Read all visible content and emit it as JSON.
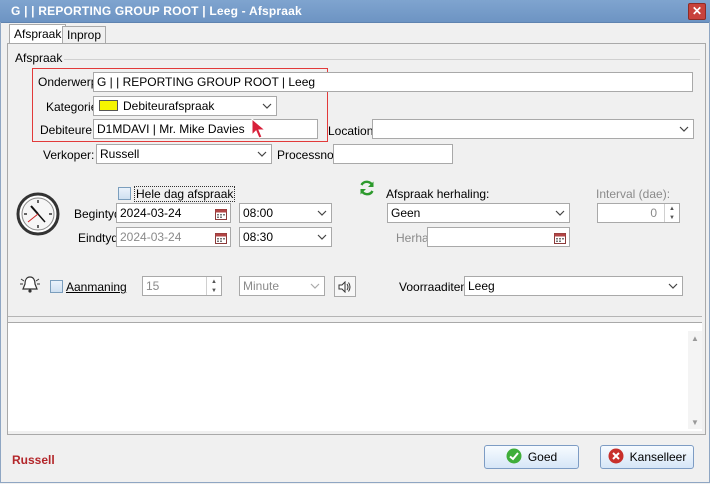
{
  "window": {
    "title": "G |  | REPORTING GROUP ROOT | Leeg - Afspraak",
    "close_glyph": "✕"
  },
  "tabs": [
    {
      "label": "Afspraak",
      "active": true
    },
    {
      "label": "Inprop",
      "active": false
    }
  ],
  "group": {
    "label": "Afspraak"
  },
  "fields": {
    "onderwerp_label": "Onderwerp",
    "onderwerp_value": "G |  | REPORTING GROUP ROOT | Leeg",
    "kategorie_label": "Kategorie",
    "kategorie_value": "Debiteurafspraak",
    "kategorie_color": "#f5f500",
    "debiteure_label": "Debiteure:",
    "debiteure_value": "D1MDAVI | Mr. Mike Davies",
    "location_label": "Location",
    "location_value": "",
    "verkoper_label": "Verkoper:",
    "verkoper_value": "Russell",
    "processno_label": "Processno:",
    "processno_value": ""
  },
  "schedule": {
    "hele_dag_label": "Hele dag afspraak",
    "begintyd_label": "Begintyd",
    "begin_date": "2024-03-24",
    "begin_time": "08:00",
    "eindtyd_label": "Eindtyd",
    "end_date": "2024-03-24",
    "end_time": "08:30"
  },
  "recurrence": {
    "label": "Afspraak herhaling:",
    "value": "Geen",
    "herhaal_tot_label": "Herhaal tot:",
    "herhaal_tot_value": "",
    "interval_label": "Interval (dae):",
    "interval_value": "0"
  },
  "reminder": {
    "aanmaning_label": "Aanmaning",
    "value": "15",
    "unit": "Minute",
    "voorraaditem_label": "Voorraaditem",
    "voorraaditem_value": "Leeg"
  },
  "footer": {
    "user": "Russell",
    "ok_label": "Goed",
    "cancel_label": "Kanselleer"
  },
  "colors": {
    "highlight": "#e23a3a",
    "ok_icon": "#3fae3a",
    "cancel_icon": "#c8302c",
    "footer_user": "#b3262a"
  }
}
